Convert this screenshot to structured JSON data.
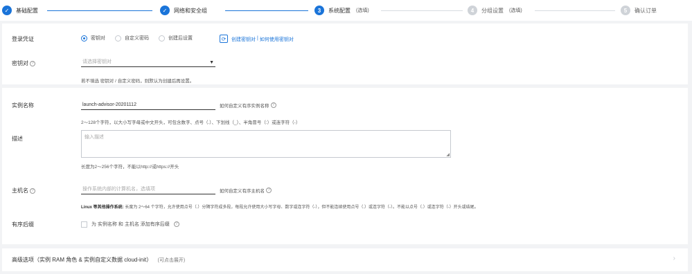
{
  "stepper": {
    "steps": [
      {
        "label": "基础配置",
        "status": "done",
        "number": "✓",
        "sub": ""
      },
      {
        "label": "网络和安全组",
        "status": "done",
        "number": "✓",
        "sub": ""
      },
      {
        "label": "系统配置",
        "status": "active",
        "number": "3",
        "sub": "(选填)"
      },
      {
        "label": "分组设置",
        "status": "todo",
        "number": "4",
        "sub": "(选填)"
      },
      {
        "label": "确认订单",
        "status": "todo",
        "number": "5",
        "sub": ""
      }
    ]
  },
  "login": {
    "label": "登录凭证",
    "options": [
      "密钥对",
      "自定义密码",
      "创建后设置"
    ],
    "selected": "密钥对"
  },
  "keypair": {
    "label": "密钥对",
    "help": "?",
    "placeholder": "请选择密钥对",
    "create_link": "创建密钥对",
    "separator": "|",
    "howto_link": "如何使用密钥对",
    "hint": "若不填选 密钥对 / 自定义密码，则默认为创建后再设置。"
  },
  "instance_name": {
    "label": "实例名称",
    "value": "launch-advisor-20201112",
    "side_help": "如何自定义有序实例名称",
    "hint": "2～128个字符，以大小写字母或中文开头，可包含数字、点号（.）、下划线（_）、半角冒号（:）或连字符（-）"
  },
  "description": {
    "label": "描述",
    "placeholder": "输入描述",
    "hint": "长度为2～256个字符，不能以http://或https://开头"
  },
  "hostname": {
    "label": "主机名",
    "placeholder": "操作系统内部的计算机名，选填项",
    "side_help": "如何自定义有序主机名",
    "hint_bold": "Linux 等其他操作系统:",
    "hint": "长度为 2～64 个字符，允许使用点号（.）分隔字符成多段，每段允许使用大小写字母、数字或连字符（-），但不能连续使用点号（.）或连字符（-）。不能以点号（.）或连字符（-）开头或结尾。"
  },
  "suffix": {
    "label": "有序后缀",
    "checkbox_text": "为 实例名称 和 主机名 添加有序后缀"
  },
  "advanced": {
    "title": "高级选项（实例 RAM 角色 & 实例自定义数据 cloud-init）",
    "sub": "(可点击展开)"
  },
  "colors": {
    "accent": "#1a74d9",
    "inactive": "#cfd3d8"
  }
}
